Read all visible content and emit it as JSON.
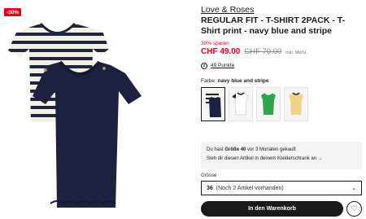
{
  "product": {
    "badge": "-30%",
    "brand": "Love & Roses",
    "title": "REGULAR FIT - T-SHIRT 2PACK - T-Shirt print - navy blue and stripe",
    "discount": "30% sparen",
    "price": "CHF 49.00",
    "old_price": "CHF 70.00",
    "vat": "inkl. MwSt.",
    "points": "49 Punkte",
    "points_icon": "Z"
  },
  "colors": {
    "label": "Farbe:",
    "selected": "navy blue and stripe",
    "swatches": [
      {
        "name": "navy blue and stripe",
        "hex": "#1e2545"
      },
      {
        "name": "white",
        "hex": "#ffffff"
      },
      {
        "name": "green",
        "hex": "#2fa54a"
      },
      {
        "name": "yellow",
        "hex": "#f0d28a"
      }
    ]
  },
  "hint": {
    "line1_pre": "Du hast",
    "line1_size": "Größe 40",
    "line1_post": "vor 3 Monaten gekauft",
    "line2": "Sieh dir diesen Artikel in deinem Kleiderschrank an →"
  },
  "size": {
    "label": "Grösse",
    "value": "36",
    "note": "(Noch 2 Artikel vorhanden)",
    "chevron": "⌄"
  },
  "actions": {
    "buy_label": "In den Warenkorb",
    "wish_icon": "♡"
  }
}
